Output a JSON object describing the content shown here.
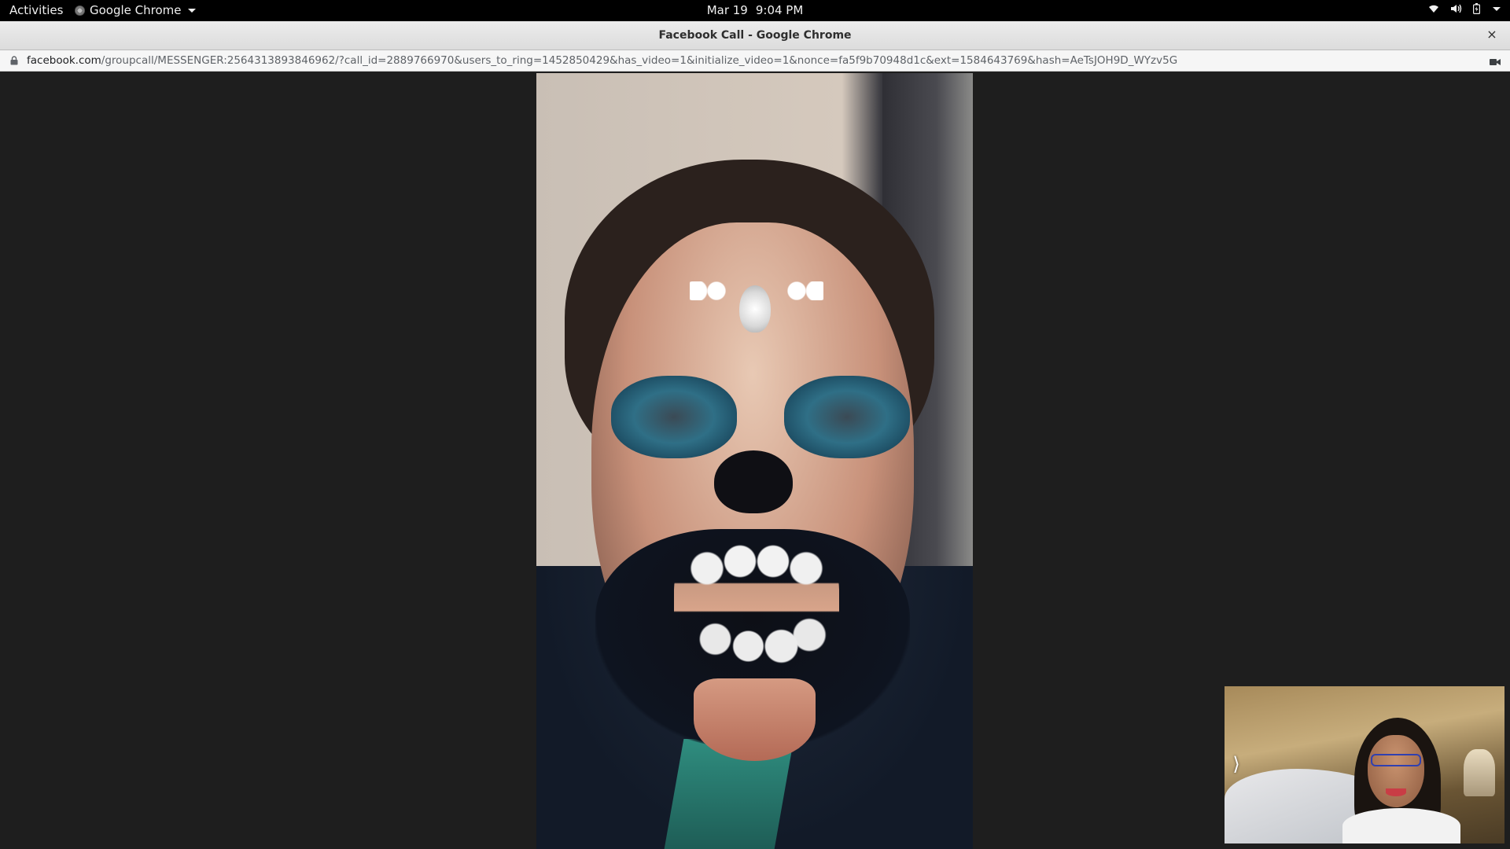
{
  "topbar": {
    "activities": "Activities",
    "app_name": "Google Chrome",
    "date": "Mar 19",
    "time": "9:04 PM",
    "icons": [
      "wifi-icon",
      "volume-icon",
      "battery-icon",
      "system-menu-caret"
    ]
  },
  "window": {
    "title": "Facebook Call - Google Chrome",
    "close_glyph": "×"
  },
  "address": {
    "host": "facebook.com",
    "path": "/groupcall/MESSENGER:2564313893846962/?call_id=2889766970&users_to_ring=1452850429&has_video=1&initialize_video=1&nonce=fa5f9b70948d1c&ext=1584643769&hash=AeTsJOH9D_WYzv5G"
  },
  "call": {
    "remote_video": "remote-participant-video",
    "self_view": "self-view-video",
    "self_view_toggle_glyph": "⟩"
  },
  "colors": {
    "topbar_bg": "#000000",
    "call_bg": "#1e1e1e",
    "titlebar_bg": "#e4e4e4"
  }
}
